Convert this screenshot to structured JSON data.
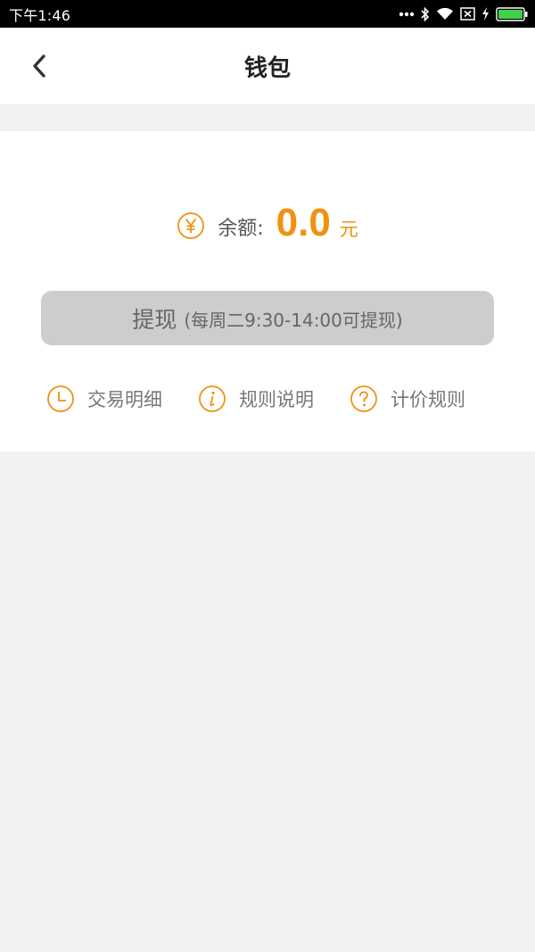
{
  "status_bar": {
    "time": "下午1:46",
    "icons": [
      "more-dots-icon",
      "bluetooth-icon",
      "wifi-icon",
      "no-sim-icon",
      "charging-bolt-icon",
      "battery-icon"
    ]
  },
  "nav": {
    "back_icon": "chevron-left-icon",
    "title": "钱包"
  },
  "balance": {
    "icon": "yen-circle-icon",
    "label": "余额:",
    "value": "0.0",
    "unit": "元"
  },
  "withdraw": {
    "label": "提现",
    "note": "(每周二9:30-14:00可提现)"
  },
  "links": [
    {
      "icon": "clock-icon",
      "label": "交易明细"
    },
    {
      "icon": "info-icon",
      "label": "规则说明"
    },
    {
      "icon": "question-icon",
      "label": "计价规则"
    }
  ],
  "colors": {
    "accent": "#f0920f",
    "background": "#f2f2f2",
    "button_disabled": "#cdcdcd"
  }
}
